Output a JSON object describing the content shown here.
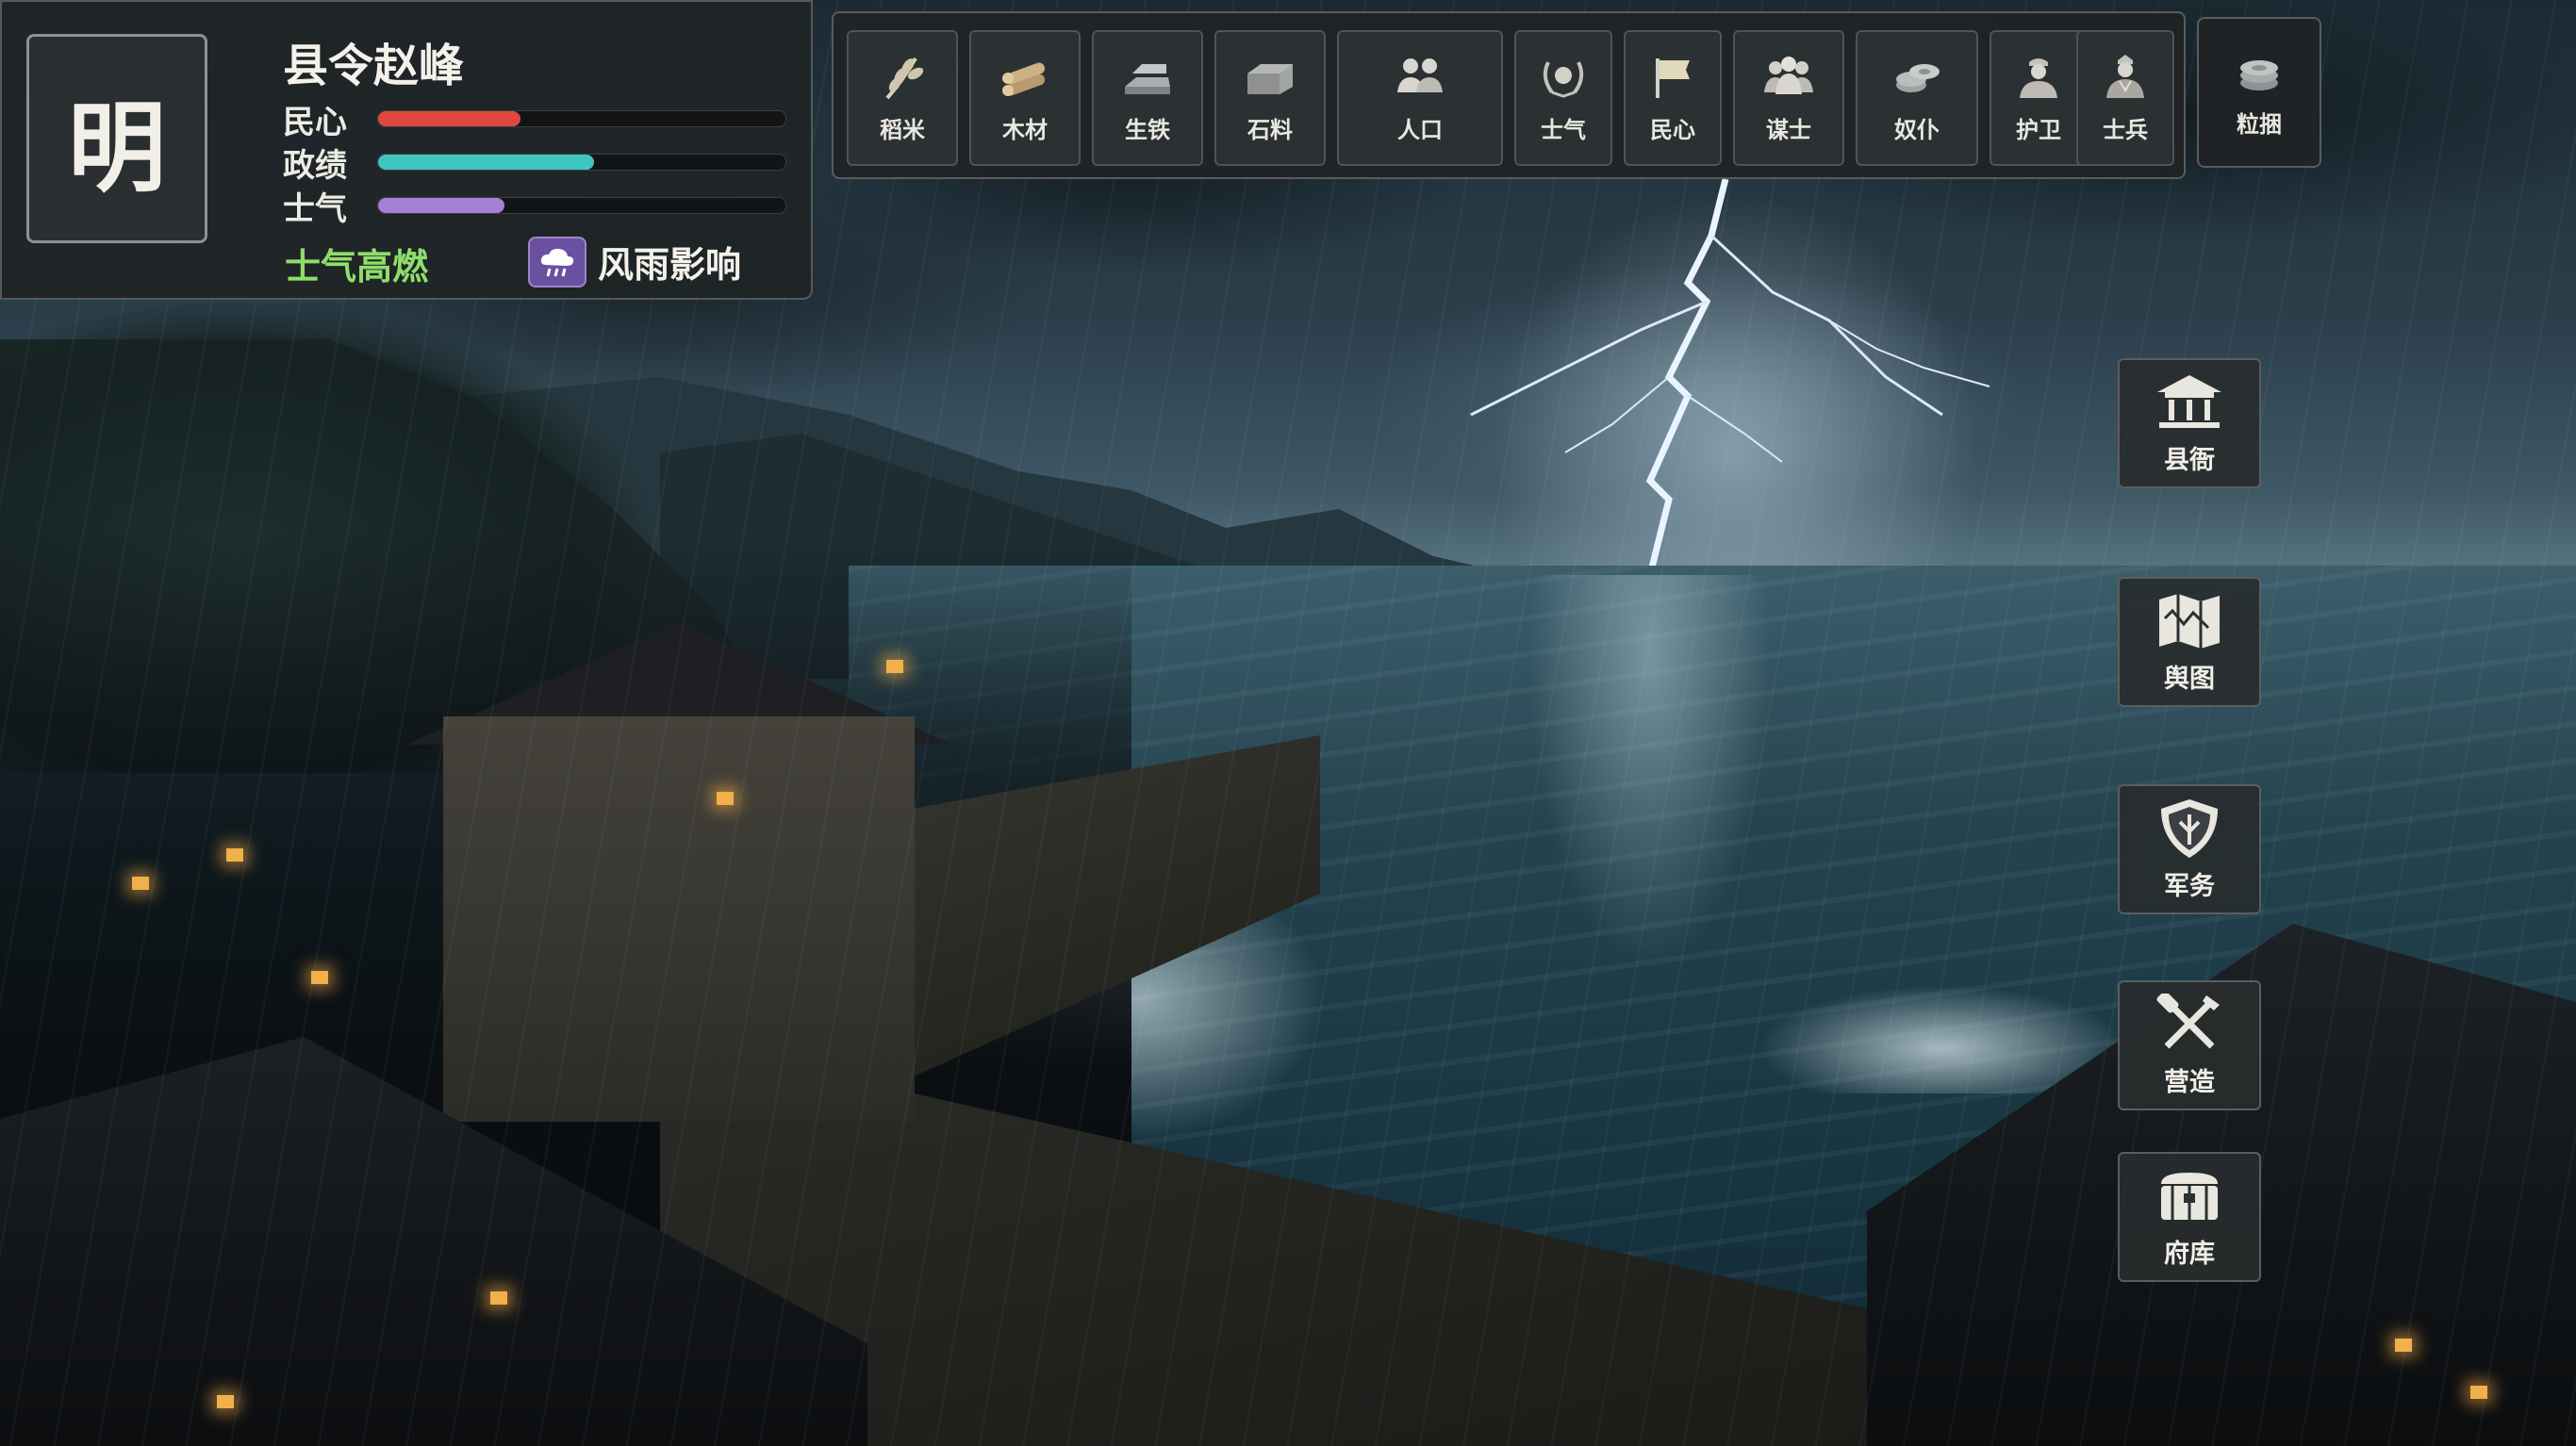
{
  "status": {
    "dynasty": "明",
    "official": "县令赵峰",
    "stats": [
      {
        "label": "民心",
        "value": 0.35,
        "color": "#e0483e"
      },
      {
        "label": "政绩",
        "value": 0.53,
        "color": "#3ec7c0"
      },
      {
        "label": "士气",
        "value": 0.31,
        "color": "#a67fd6"
      }
    ],
    "morale_status": "士气高燃",
    "weather": "风雨影响"
  },
  "resources": [
    {
      "label": "稻米",
      "icon": "rice-icon"
    },
    {
      "label": "木材",
      "icon": "wood-icon"
    },
    {
      "label": "生铁",
      "icon": "iron-icon"
    },
    {
      "label": "石料",
      "icon": "stone-icon"
    },
    {
      "label": "人口",
      "icon": "population-icon"
    },
    {
      "label": "士气",
      "icon": "laurel-icon"
    },
    {
      "label": "民心",
      "icon": "flag-icon"
    },
    {
      "label": "谋士",
      "icon": "advisors-icon"
    },
    {
      "label": "奴仆",
      "icon": "coins-icon"
    },
    {
      "label": "护卫",
      "icon": "guard-icon"
    },
    {
      "label": "士兵",
      "icon": "soldier-icon"
    }
  ],
  "extra": {
    "label": "粒捆",
    "icon": "coin-stack-icon"
  },
  "side_menu": [
    {
      "label": "县衙",
      "icon": "yamen-icon"
    },
    {
      "label": "舆图",
      "icon": "map-icon"
    },
    {
      "label": "军务",
      "icon": "shield-icon"
    },
    {
      "label": "营造",
      "icon": "tools-icon"
    },
    {
      "label": "府库",
      "icon": "treasury-icon"
    }
  ],
  "colors": {
    "morale_status": "#8fde6a",
    "weather_badge": "#6b4fa0",
    "panel_bg": "#202426"
  }
}
